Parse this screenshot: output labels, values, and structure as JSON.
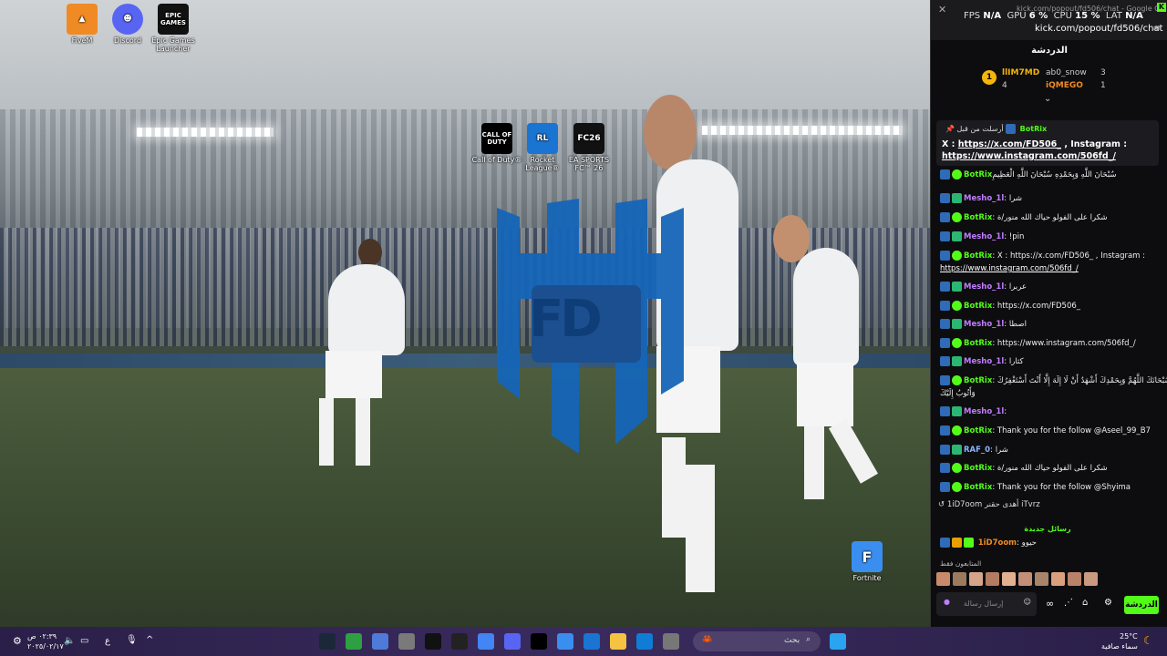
{
  "desktop": {
    "icons_top": [
      {
        "label": "FiveM",
        "color": "#f08a24"
      },
      {
        "label": "Discord",
        "color": "#5865f2"
      },
      {
        "label": "Epic Games Launcher",
        "color": "#111111",
        "glyph": "EPIC GAMES"
      }
    ],
    "icons_mid": [
      {
        "label": "Call of Duty®",
        "glyph": "CALL OF DUTY"
      },
      {
        "label": "Rocket League®",
        "glyph": "RL"
      },
      {
        "label": "EA SPORTS FC™ 26",
        "glyph": "FC26"
      }
    ],
    "fortnite": {
      "label": "Fortnite",
      "glyph": "F"
    },
    "logo_text": "FD"
  },
  "overlay": {
    "window_title": "kick.com/popout/fd506/chat - Google C...",
    "fps_label": "FPS",
    "fps_value": "N/A",
    "gpu_label": "GPU",
    "gpu_value": "6 %",
    "cpu_label": "CPU",
    "cpu_value": "15 %",
    "lat_label": "LAT",
    "lat_value": "N/A",
    "url": "kick.com/popout/fd506/chat",
    "chat_title": "الدردشة",
    "leaderboard": [
      {
        "rank": "1",
        "name": "llIM7MD",
        "count": "4"
      },
      {
        "name": "ab0_snow",
        "count": "3"
      },
      {
        "name": "iQMEGO",
        "count": "1"
      }
    ],
    "pinned": {
      "by": "أرسلت من قبل",
      "user": "BotRix",
      "line1_a": "X : ",
      "line1_link": "https://x.com/FD506_",
      "line1_b": " , Instagram :",
      "line2_link": "https://www.instagram.com/506fd_/"
    },
    "messages": [
      {
        "user": "BotRix",
        "text": "سُبْحَانَ اللَّهِ وَبِحَمْدِهِ سُبْحَانَ اللَّهِ الْعَظِيمِ",
        "cls": "green"
      },
      {
        "user": "Mesho_1l",
        "text": ": شرا",
        "cls": "purple"
      },
      {
        "user": "BotRix",
        "text": ": شكرا على الفولو حياك الله منور/ة",
        "cls": "green"
      },
      {
        "user": "Mesho_1l",
        "text": ": !pin",
        "cls": "purple"
      },
      {
        "user": "BotRix",
        "text": ": X : https://x.com/FD506_ , Instagram :",
        "cls": "green"
      },
      {
        "user": "",
        "text": "https://www.instagram.com/506fd_/",
        "cls": "link"
      },
      {
        "user": "Mesho_1l",
        "text": ": عربرا",
        "cls": "purple"
      },
      {
        "user": "BotRix",
        "text": ": https://x.com/FD506_",
        "cls": "green"
      },
      {
        "user": "Mesho_1l",
        "text": ": اصطا",
        "cls": "purple"
      },
      {
        "user": "BotRix",
        "text": ": https://www.instagram.com/506fd_/",
        "cls": "green"
      },
      {
        "user": "Mesho_1l",
        "text": ": كثارا",
        "cls": "purple"
      },
      {
        "user": "BotRix",
        "text": ": سُبْحَانَكَ اللَّهُمَّ وَبِحَمْدِكَ أَشْهَدُ أَنْ لَا إِلَهَ إِلَّا أَنْتَ أَسْتَغْفِرُكَ",
        "cls": "green"
      },
      {
        "user": "",
        "text": "وَأَتُوبُ إِلَيْكَ",
        "cls": "plain"
      },
      {
        "user": "Mesho_1l",
        "text": ":",
        "cls": "purple"
      },
      {
        "user": "BotRix",
        "text": ": Thank you for the follow @Aseel_99_B7",
        "cls": "green"
      },
      {
        "user": "RAF_0",
        "text": ": شرا",
        "cls": "blue"
      },
      {
        "user": "BotRix",
        "text": ": شكرا على الفولو حياك الله منور/ة",
        "cls": "green"
      },
      {
        "user": "BotRix",
        "text": ": Thank you for the follow @Shyima",
        "cls": "green"
      }
    ],
    "reply_notice": "1iD7oom أهدى حقنر iTvrz",
    "new_messages": "رسائل جديدة",
    "last_msg": {
      "user": "1iD7oom",
      "text": ": حيوو"
    },
    "followers_only": "المتابعون فقط",
    "input_placeholder": "إرسال رسالة",
    "chat_button": "الدردشة"
  },
  "taskbar": {
    "search_placeholder": "بحث",
    "time": "٠٢:٣٩ ص",
    "date": "٢٠٢٥/٠٢/١٧",
    "weather_temp": "25°C",
    "weather_text": "سماء صافية",
    "lang": "ع"
  }
}
